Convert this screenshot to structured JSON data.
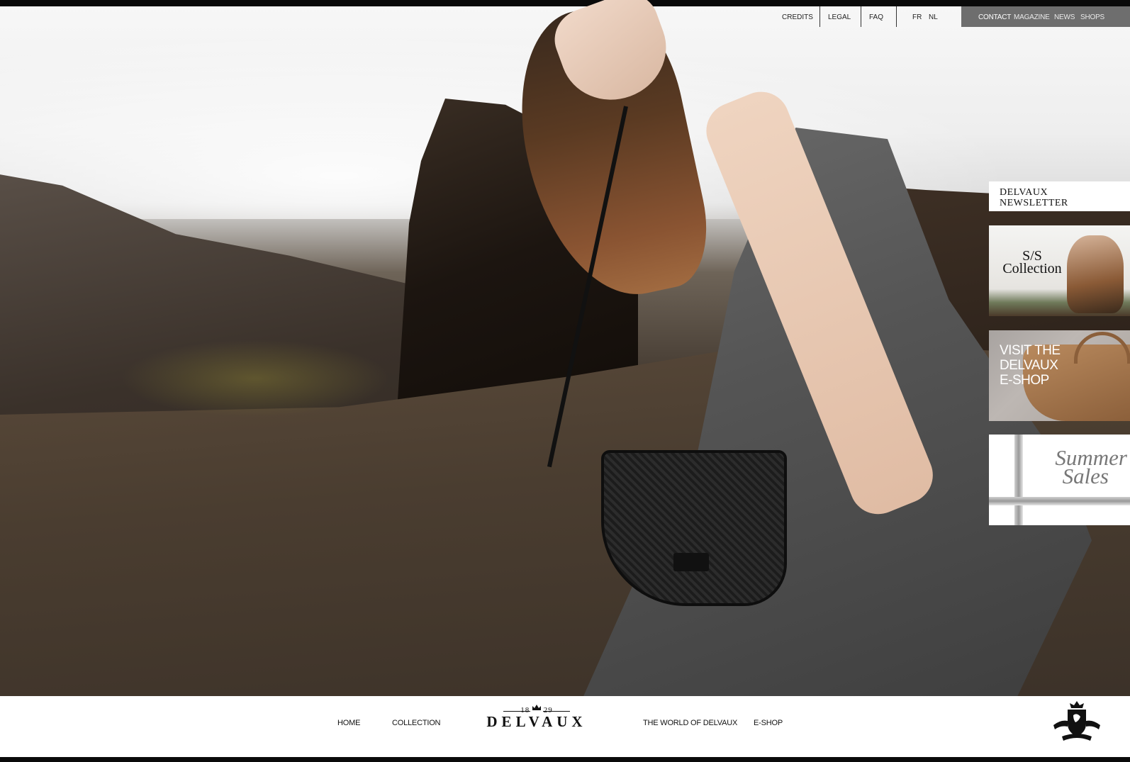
{
  "top_nav": {
    "white": [
      {
        "label": "CREDITS"
      },
      {
        "label": "LEGAL"
      },
      {
        "label": "FAQ"
      }
    ],
    "languages": [
      {
        "label": "FR"
      },
      {
        "label": "NL"
      }
    ],
    "dark": [
      {
        "label": "CONTACT",
        "active": true
      },
      {
        "label": "MAGAZINE"
      },
      {
        "label": "NEWS"
      },
      {
        "label": "SHOPS"
      }
    ]
  },
  "promos": {
    "newsletter": {
      "label": "DELVAUX\nNEWSLETTER"
    },
    "collection": {
      "line1": "S/S",
      "line2": "Collection"
    },
    "eshop": {
      "line1": "VISIT THE",
      "line2": "DELVAUX",
      "line3": "E-SHOP"
    },
    "sales": {
      "line1": "Summer",
      "line2": "Sales"
    }
  },
  "footer": {
    "nav": [
      {
        "label": "HOME"
      },
      {
        "label": "COLLECTION"
      },
      {
        "label": "THE WORLD OF DELVAUX"
      },
      {
        "label": "E-SHOP"
      }
    ],
    "logo": {
      "year_left": "18",
      "year_right": "29",
      "name": "DELVAUX"
    }
  },
  "colors": {
    "dark_nav_bg": "#6e6e6e",
    "page_border": "#0a0a0a"
  },
  "icons": {
    "crest": "royal-crest-icon",
    "crown": "crown-icon"
  }
}
